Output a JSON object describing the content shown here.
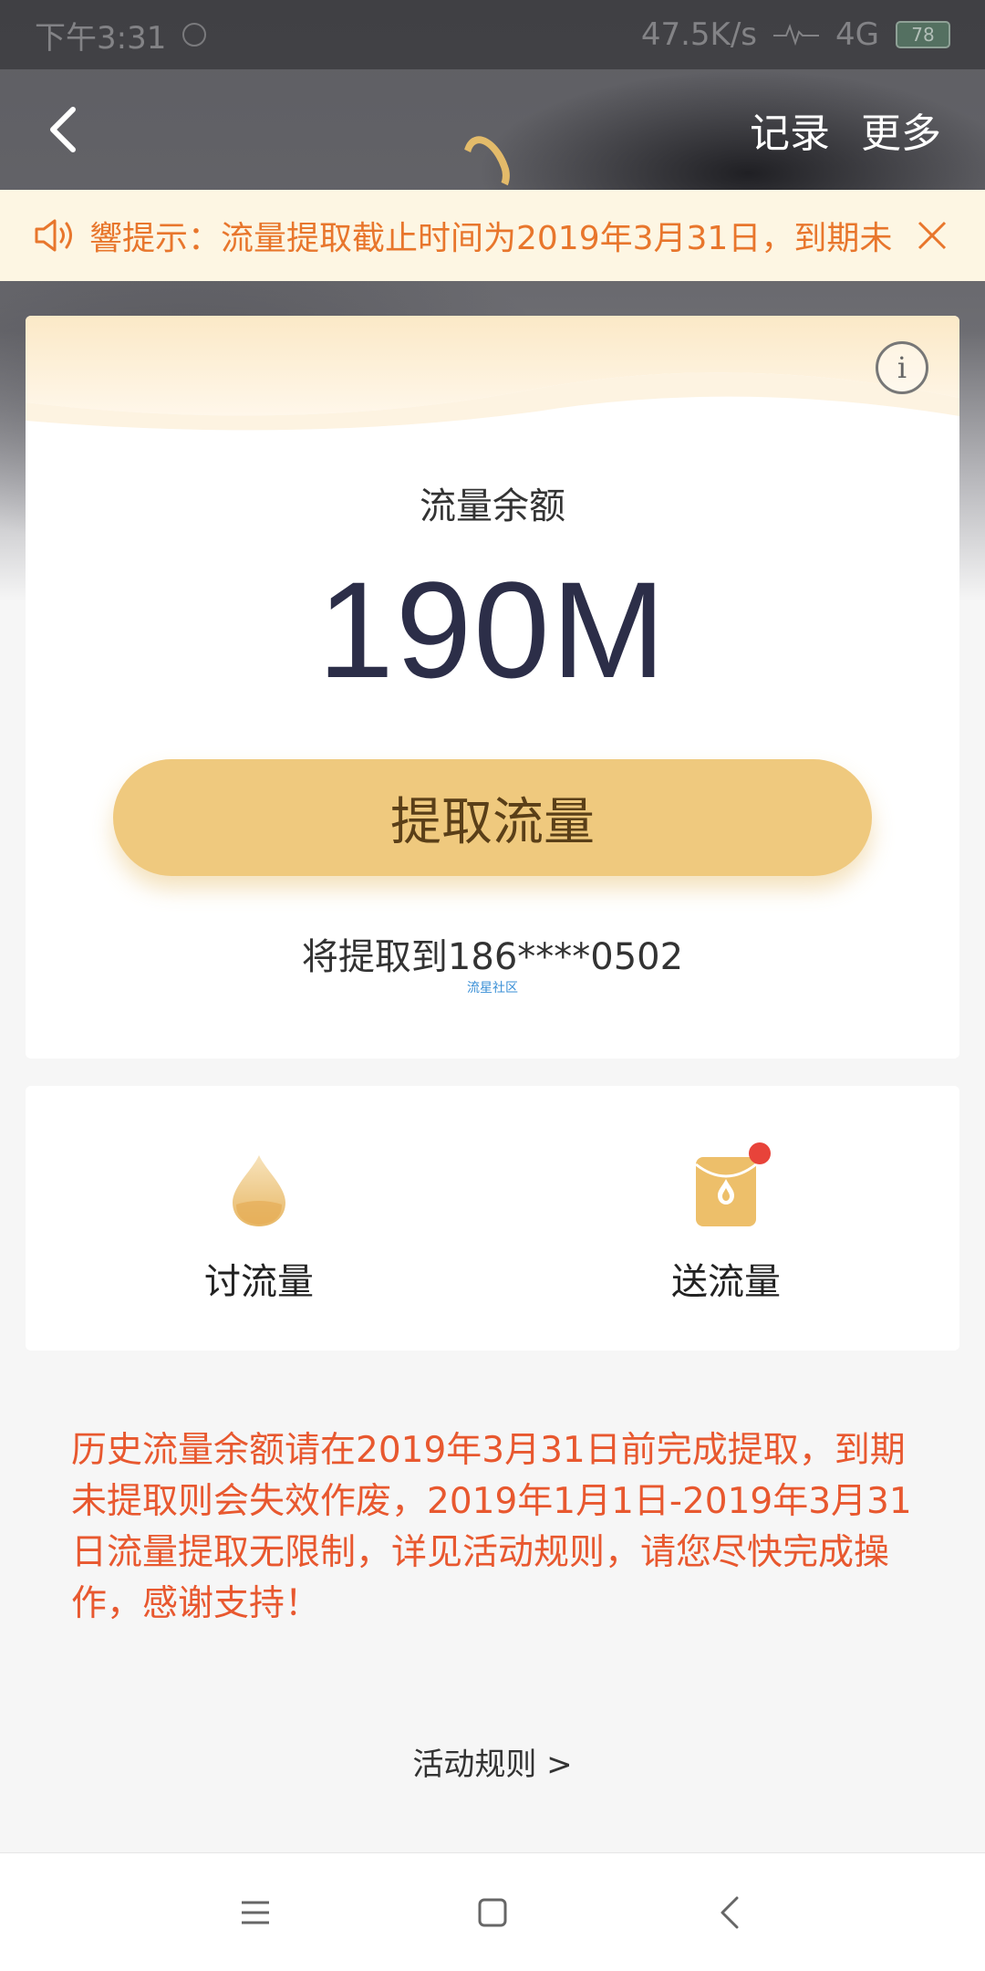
{
  "status_bar": {
    "time": "下午3:31",
    "net_speed": "47.5K/s",
    "network": "4G",
    "battery": "78"
  },
  "nav": {
    "records": "记录",
    "more": "更多"
  },
  "notice": {
    "text": "響提示：流量提取截止时间为2019年3月31日，到期未"
  },
  "balance": {
    "label": "流量余额",
    "value": "190M",
    "extract_button": "提取流量",
    "target": "将提取到186****0502",
    "watermark": "流星社区"
  },
  "actions": [
    {
      "label": "讨流量",
      "icon": "drop-icon"
    },
    {
      "label": "送流量",
      "icon": "red-envelope-icon"
    }
  ],
  "history_note": "历史流量余额请在2019年3月31日前完成提取，到期未提取则会失效作废，2019年1月1日-2019年3月31日流量提取无限制，详见活动规则，请您尽快完成操作，感谢支持！",
  "rules_link": "活动规则 >",
  "colors": {
    "accent_gold": "#efc97e",
    "notice_orange": "#e8762c",
    "note_red": "#e8582f",
    "balance_text": "#2c2e48"
  }
}
